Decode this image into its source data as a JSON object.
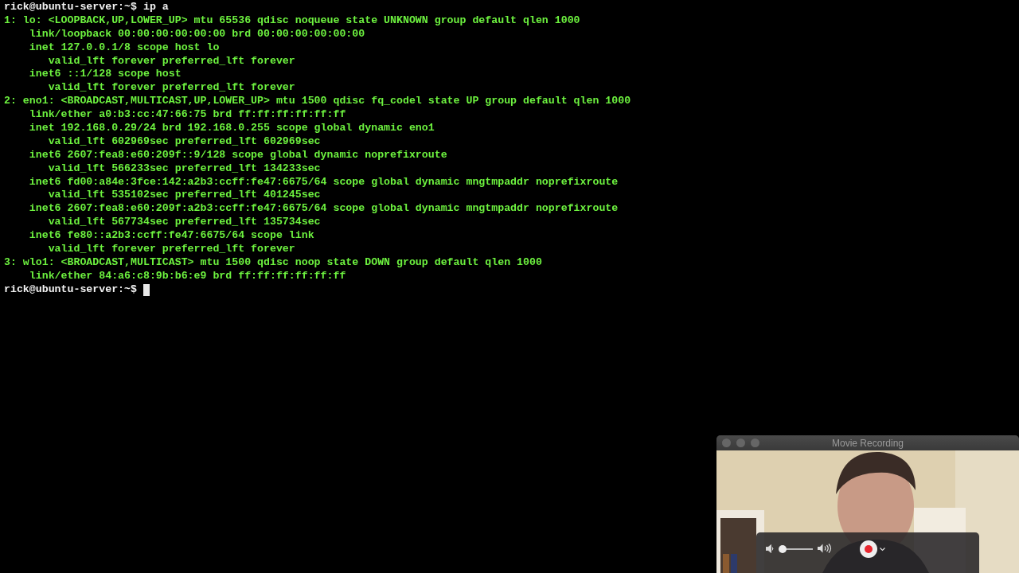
{
  "terminal": {
    "lines": [
      {
        "kind": "prompt",
        "prompt": "rick@ubuntu-server:~$",
        "command": "ip a"
      },
      {
        "kind": "output",
        "text": "1: lo: <LOOPBACK,UP,LOWER_UP> mtu 65536 qdisc noqueue state UNKNOWN group default qlen 1000"
      },
      {
        "kind": "output",
        "text": "    link/loopback 00:00:00:00:00:00 brd 00:00:00:00:00:00"
      },
      {
        "kind": "output",
        "text": "    inet 127.0.0.1/8 scope host lo"
      },
      {
        "kind": "output",
        "text": "       valid_lft forever preferred_lft forever"
      },
      {
        "kind": "output",
        "text": "    inet6 ::1/128 scope host"
      },
      {
        "kind": "output",
        "text": "       valid_lft forever preferred_lft forever"
      },
      {
        "kind": "output",
        "text": "2: eno1: <BROADCAST,MULTICAST,UP,LOWER_UP> mtu 1500 qdisc fq_codel state UP group default qlen 1000"
      },
      {
        "kind": "output",
        "text": "    link/ether a0:b3:cc:47:66:75 brd ff:ff:ff:ff:ff:ff"
      },
      {
        "kind": "output",
        "text": "    inet 192.168.0.29/24 brd 192.168.0.255 scope global dynamic eno1"
      },
      {
        "kind": "output",
        "text": "       valid_lft 602969sec preferred_lft 602969sec"
      },
      {
        "kind": "output",
        "text": "    inet6 2607:fea8:e60:209f::9/128 scope global dynamic noprefixroute"
      },
      {
        "kind": "output",
        "text": "       valid_lft 566233sec preferred_lft 134233sec"
      },
      {
        "kind": "output",
        "text": "    inet6 fd00:a84e:3fce:142:a2b3:ccff:fe47:6675/64 scope global dynamic mngtmpaddr noprefixroute"
      },
      {
        "kind": "output",
        "text": "       valid_lft 535102sec preferred_lft 401245sec"
      },
      {
        "kind": "output",
        "text": "    inet6 2607:fea8:e60:209f:a2b3:ccff:fe47:6675/64 scope global dynamic mngtmpaddr noprefixroute"
      },
      {
        "kind": "output",
        "text": "       valid_lft 567734sec preferred_lft 135734sec"
      },
      {
        "kind": "output",
        "text": "    inet6 fe80::a2b3:ccff:fe47:6675/64 scope link"
      },
      {
        "kind": "output",
        "text": "       valid_lft forever preferred_lft forever"
      },
      {
        "kind": "output",
        "text": "3: wlo1: <BROADCAST,MULTICAST> mtu 1500 qdisc noop state DOWN group default qlen 1000"
      },
      {
        "kind": "output",
        "text": "    link/ether 84:a6:c8:9b:b6:e9 brd ff:ff:ff:ff:ff:ff"
      },
      {
        "kind": "prompt",
        "prompt": "rick@ubuntu-server:~$",
        "cursor": true
      }
    ]
  },
  "recording_window": {
    "title": "Movie Recording",
    "volume": {
      "level": 0.05
    }
  }
}
